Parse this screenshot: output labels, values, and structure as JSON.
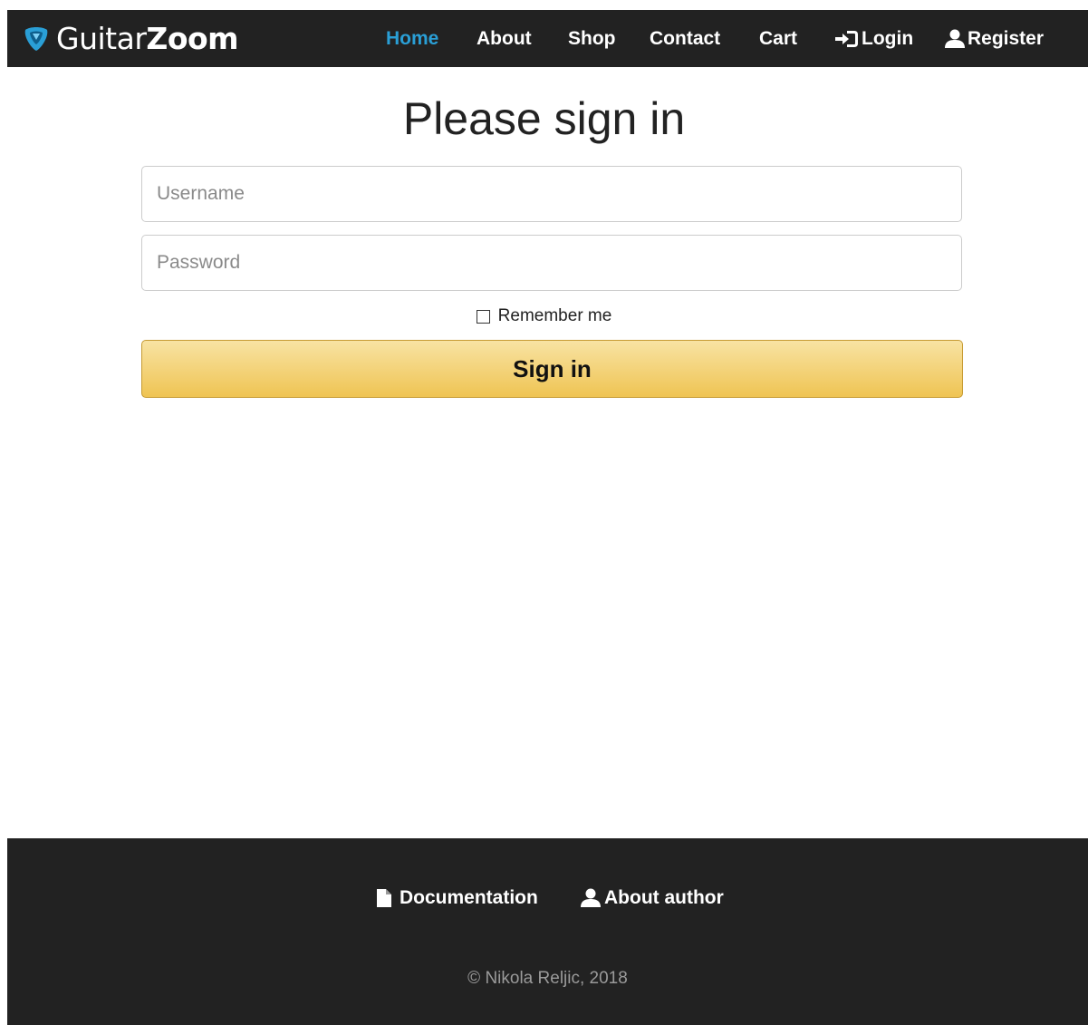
{
  "brand": {
    "name_thin": "Guitar",
    "name_bold": "Zoom"
  },
  "nav": {
    "home": "Home",
    "about": "About",
    "shop": "Shop",
    "contact": "Contact",
    "cart": "Cart",
    "login": "Login",
    "register": "Register"
  },
  "main": {
    "title": "Please sign in",
    "username_placeholder": "Username",
    "password_placeholder": "Password",
    "remember_label": "Remember me",
    "remember_checked": false,
    "signin_label": "Sign in"
  },
  "footer": {
    "documentation": "Documentation",
    "about_author": "About author",
    "copyright": "© Nikola Reljic, 2018"
  },
  "colors": {
    "navbar_bg": "#222222",
    "active_link": "#2a9fd6",
    "button_gradient_top": "#f8e3a3",
    "button_gradient_bottom": "#efc453",
    "logo_blue": "#2a9fd6"
  },
  "icons": {
    "brand": "guitar-pick-icon",
    "login": "sign-in-icon",
    "register": "user-icon",
    "documentation": "file-icon",
    "about_author": "user-icon"
  }
}
